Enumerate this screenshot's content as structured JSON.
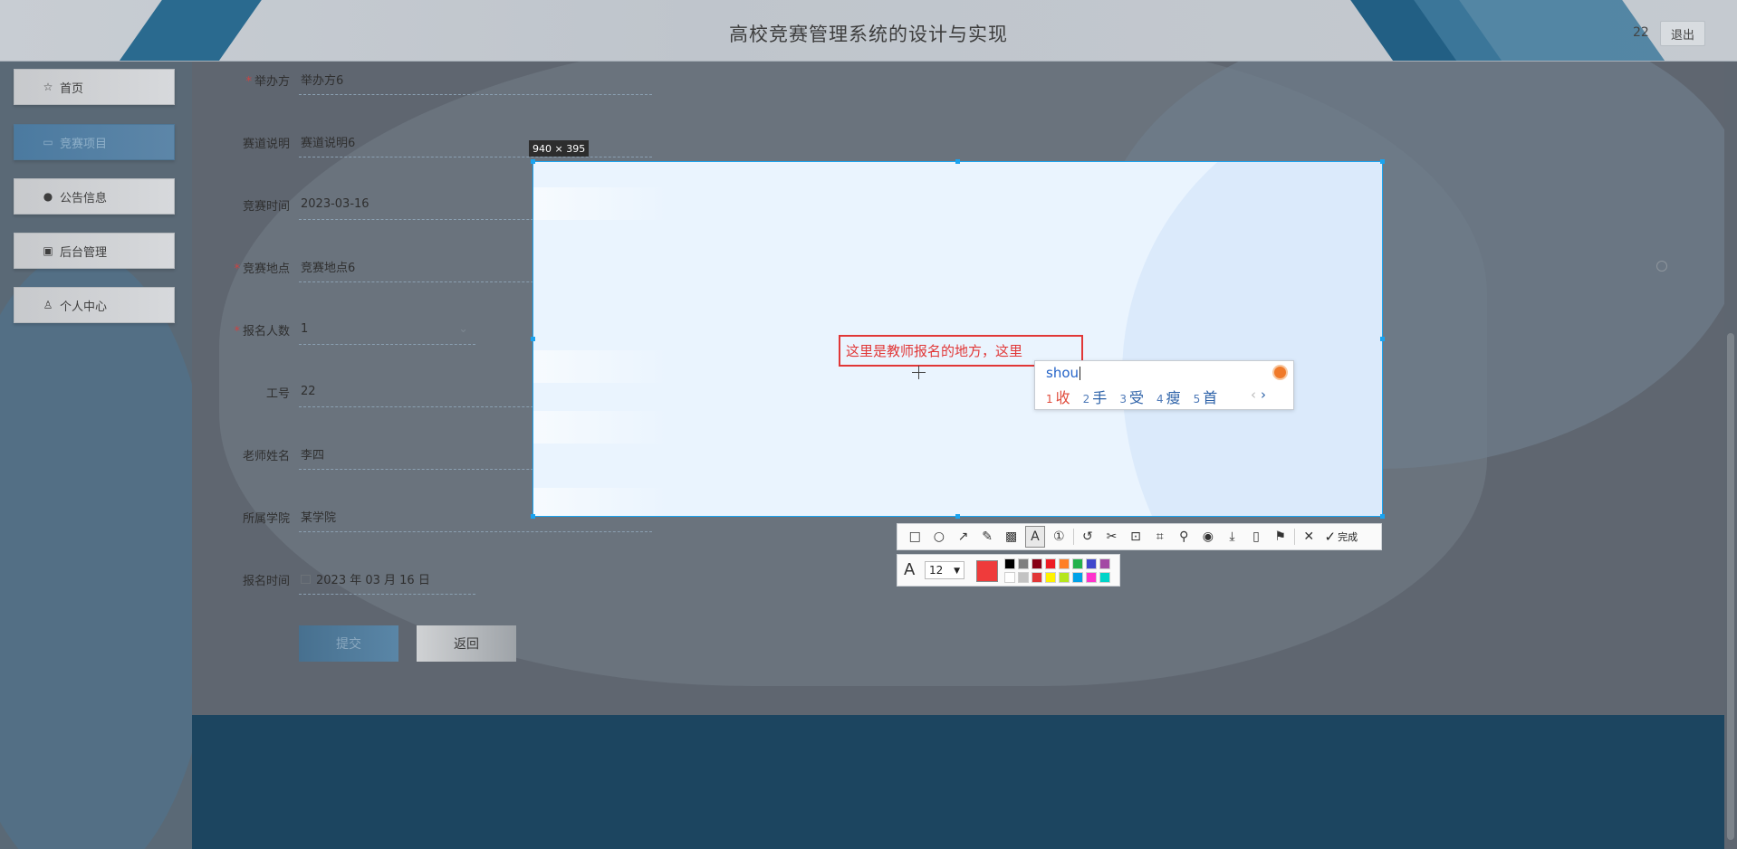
{
  "header": {
    "title": "高校竞赛管理系统的设计与实现",
    "user": "22",
    "logout_label": "退出"
  },
  "sidebar": {
    "items": [
      {
        "label": "首页",
        "icon": "home-icon",
        "glyph": "☆"
      },
      {
        "label": "竞赛项目",
        "icon": "folder-icon",
        "glyph": "▭",
        "active": true
      },
      {
        "label": "公告信息",
        "icon": "info-icon",
        "glyph": "●"
      },
      {
        "label": "后台管理",
        "icon": "briefcase-icon",
        "glyph": "▣"
      },
      {
        "label": "个人中心",
        "icon": "user-icon",
        "glyph": "♙"
      }
    ]
  },
  "form": {
    "fields": [
      {
        "label": "举办方",
        "required": true,
        "value": "举办方6"
      },
      {
        "label": "赛道说明",
        "required": false,
        "value": "赛道说明6"
      },
      {
        "label": "竞赛时间",
        "required": false,
        "value": "2023-03-16"
      },
      {
        "label": "竞赛地点",
        "required": true,
        "value": "竞赛地点6"
      },
      {
        "label": "报名人数",
        "required": true,
        "value": "1"
      },
      {
        "label": "工号",
        "required": false,
        "value": "22"
      },
      {
        "label": "老师姓名",
        "required": false,
        "value": "李四"
      },
      {
        "label": "所属学院",
        "required": false,
        "value": "某学院"
      },
      {
        "label": "报名时间",
        "required": false,
        "value": "2023 年 03 月 16 日"
      }
    ],
    "submit_label": "提交",
    "back_label": "返回"
  },
  "capture": {
    "size_label": "940 × 395",
    "annotation_text": "这里是教师报名的地方，这里"
  },
  "ime": {
    "composition": "shou",
    "candidates": [
      {
        "num": "1",
        "text": "收"
      },
      {
        "num": "2",
        "text": "手"
      },
      {
        "num": "3",
        "text": "受"
      },
      {
        "num": "4",
        "text": "瘦"
      },
      {
        "num": "5",
        "text": "首"
      }
    ],
    "prev": "‹",
    "next": "›"
  },
  "toolbar": {
    "tools": [
      {
        "name": "rectangle-tool-icon",
        "glyph": "□"
      },
      {
        "name": "ellipse-tool-icon",
        "glyph": "○"
      },
      {
        "name": "arrow-tool-icon",
        "glyph": "↗"
      },
      {
        "name": "pen-tool-icon",
        "glyph": "✎"
      },
      {
        "name": "mosaic-tool-icon",
        "glyph": "▩"
      },
      {
        "name": "text-tool-icon",
        "glyph": "A",
        "active": true
      },
      {
        "name": "number-tool-icon",
        "glyph": "①"
      },
      {
        "sep": true
      },
      {
        "name": "undo-icon",
        "glyph": "↺"
      },
      {
        "name": "scissors-icon",
        "glyph": "✂"
      },
      {
        "name": "ocr-icon",
        "glyph": "⊡"
      },
      {
        "name": "crop-icon",
        "glyph": "⌗"
      },
      {
        "name": "pin-icon",
        "glyph": "⚲"
      },
      {
        "name": "record-icon",
        "glyph": "◉"
      },
      {
        "name": "download-icon",
        "glyph": "⤓"
      },
      {
        "name": "long-screenshot-icon",
        "glyph": "▯"
      },
      {
        "name": "bookmark-icon",
        "glyph": "⚑"
      },
      {
        "sep": true
      },
      {
        "name": "close-icon",
        "glyph": "✕"
      }
    ],
    "done_label": "完成"
  },
  "text_options": {
    "font_size": "12",
    "current_color": "#ef3b3b",
    "palette": [
      "#000000",
      "#7f7f7f",
      "#880015",
      "#ed1c24",
      "#ff7f27",
      "#22b14c",
      "#3f48cc",
      "#a349a4",
      "#ffffff",
      "#c3c3c3",
      "#e13737",
      "#fff200",
      "#b5e61d",
      "#00a2e8",
      "#ff33cc",
      "#00d4c8"
    ]
  }
}
